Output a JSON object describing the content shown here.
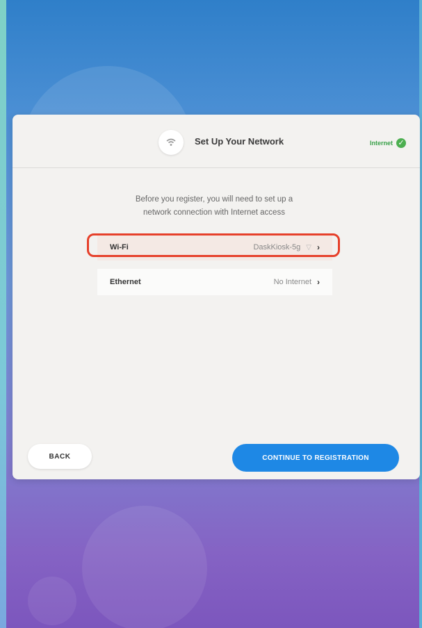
{
  "header": {
    "title": "Set Up Your Network",
    "internet_status_label": "Internet",
    "internet_status_color": "#4caf50"
  },
  "intro": {
    "line1": "Before you register, you will need to set up a",
    "line2": "network connection with Internet access"
  },
  "networks": [
    {
      "name": "Wi-Fi",
      "value": "DaskKiosk-5g",
      "highlighted": true
    },
    {
      "name": "Ethernet",
      "value": "No Internet",
      "highlighted": false
    }
  ],
  "buttons": {
    "back": "BACK",
    "continue": "CONTINUE TO REGISTRATION"
  },
  "colors": {
    "primary": "#1e88e5",
    "highlight_outline": "#e6402a"
  }
}
